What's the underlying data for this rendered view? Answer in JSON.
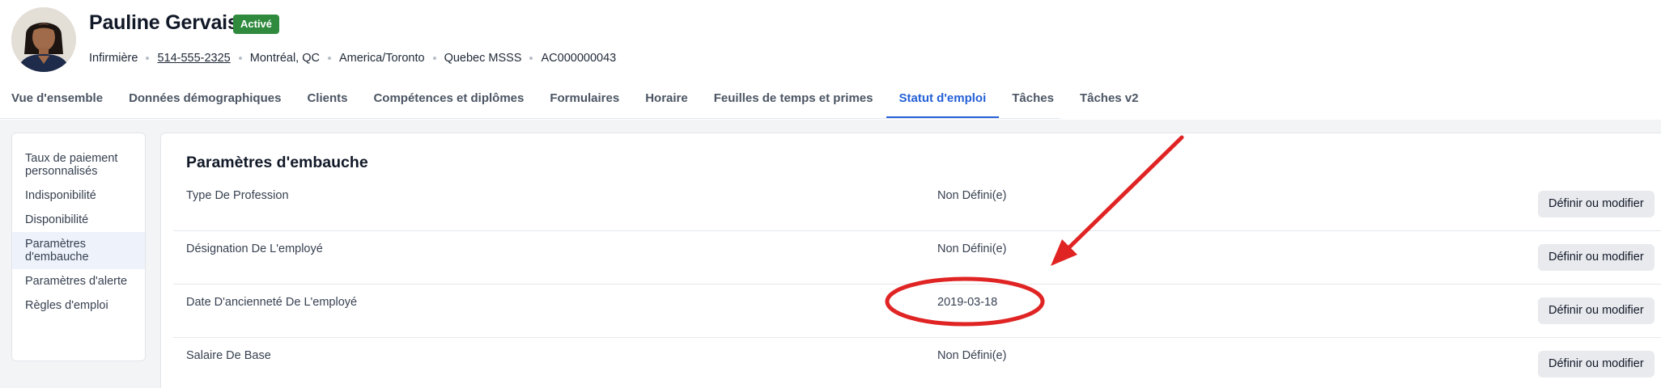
{
  "profile": {
    "name": "Pauline Gervais",
    "status": "Activé",
    "meta": [
      "Infirmière",
      "514-555-2325",
      "Montréal, QC",
      "America/Toronto",
      "Quebec MSSS",
      "AC000000043"
    ]
  },
  "tabs": [
    "Vue d'ensemble",
    "Données démographiques",
    "Clients",
    "Compétences et diplômes",
    "Formulaires",
    "Horaire",
    "Feuilles de temps et primes",
    "Statut d'emploi",
    "Tâches",
    "Tâches v2"
  ],
  "active_tab": "Statut d'emploi",
  "sidebar": {
    "items": [
      "Taux de paiement personnalisés",
      "Indisponibilité",
      "Disponibilité",
      "Paramètres d'embauche",
      "Paramètres d'alerte",
      "Règles d'emploi"
    ],
    "active": "Paramètres d'embauche"
  },
  "section": {
    "title": "Paramètres d'embauche",
    "rows": [
      {
        "label": "Type De Profession",
        "value": "Non Défini(e)",
        "button": "Définir ou modifier"
      },
      {
        "label": "Désignation De L'employé",
        "value": "Non Défini(e)",
        "button": "Définir ou modifier"
      },
      {
        "label": "Date D'ancienneté De L'employé",
        "value": "2019-03-18",
        "button": "Définir ou modifier"
      },
      {
        "label": "Salaire De Base",
        "value": "Non Défini(e)",
        "button": "Définir ou modifier"
      }
    ]
  },
  "colors": {
    "accent": "#2460d6",
    "badge": "#2f8a3e",
    "annotation": "#e02424"
  }
}
